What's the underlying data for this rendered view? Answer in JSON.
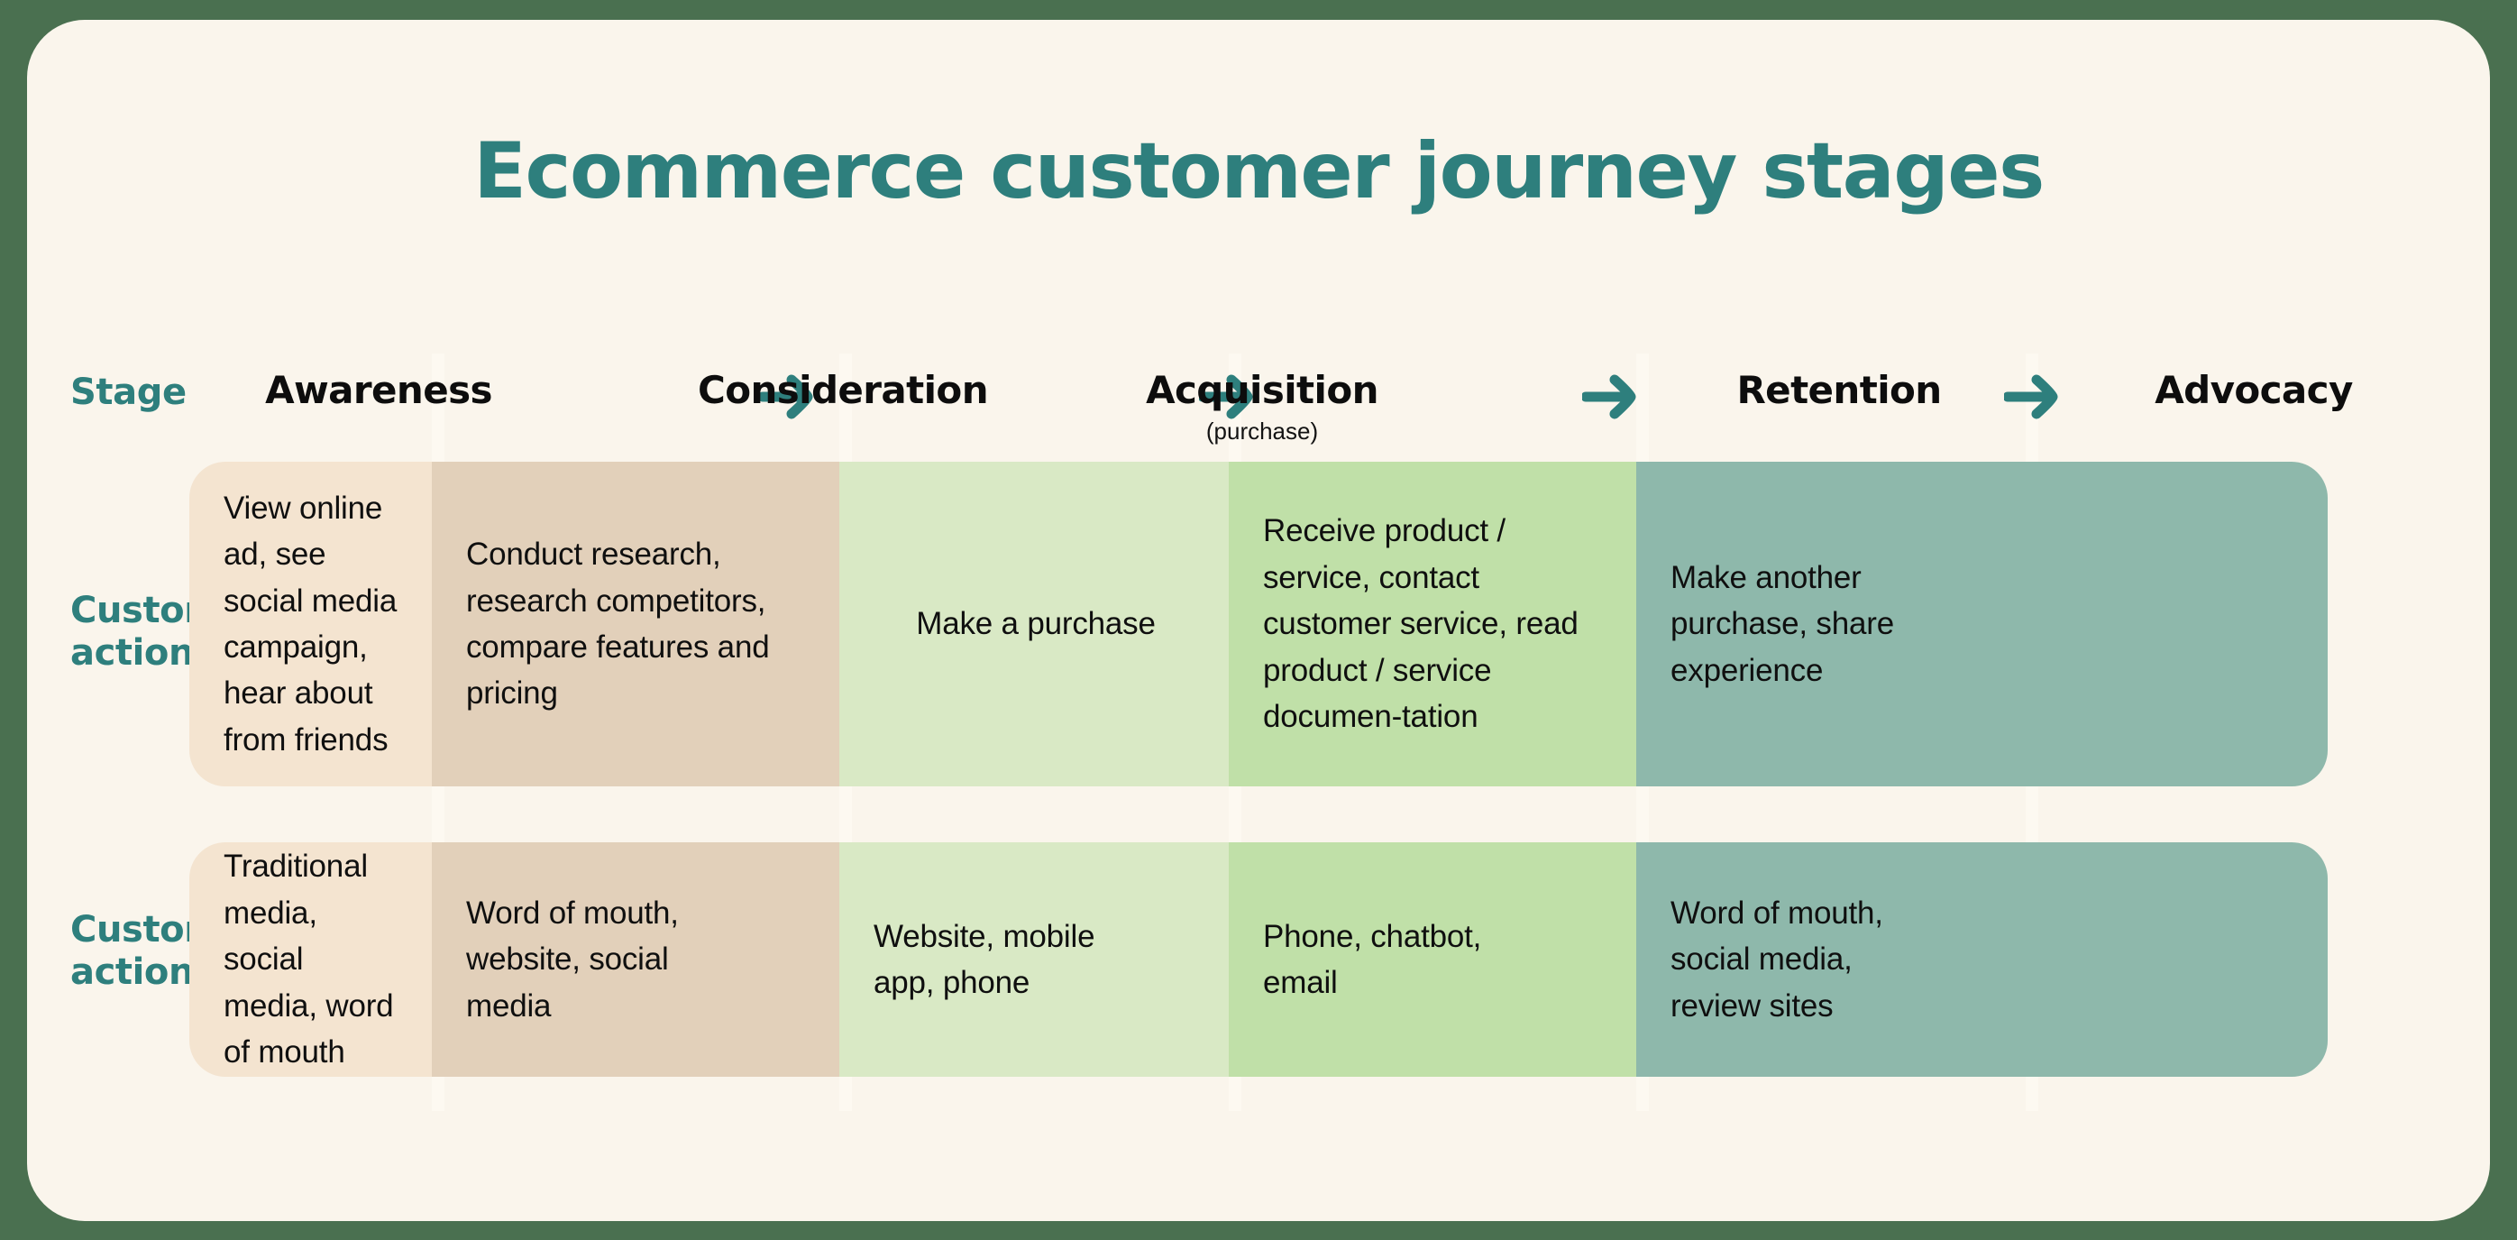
{
  "title": "Ecommerce customer journey stages",
  "colors": {
    "page_background": "#4a7050",
    "card_background": "#faf5ec",
    "accent_teal": "#2e7f7d",
    "text_dark": "#0f0f0f",
    "awareness": "#f4e4d0",
    "consideration": "#e2d0ba",
    "acquisition": "#d9e9c5",
    "retention": "#c0e0a8",
    "advocacy": "#8eb8ab"
  },
  "row_labels": {
    "stage": "Stage",
    "actions": "Customer\nactions",
    "actions_line1": "Customer",
    "actions_line2": "actions",
    "channels_line1": "Customer",
    "channels_line2": "actions"
  },
  "arrow_icon": "arrow-right-icon",
  "stages": [
    {
      "name": "Awareness",
      "subtitle": ""
    },
    {
      "name": "Consideration",
      "subtitle": ""
    },
    {
      "name": "Acquisition",
      "subtitle": "(purchase)"
    },
    {
      "name": "Retention",
      "subtitle": ""
    },
    {
      "name": "Advocacy",
      "subtitle": ""
    }
  ],
  "rows": [
    {
      "label_line1": "Customer",
      "label_line2": "actions",
      "cells": [
        "View online ad, see social media campaign, hear about from friends",
        "Conduct research, research competitors, compare features and pricing",
        "Make a purchase",
        "Receive product / service, contact customer service, read product / service documen-tation",
        "Make another purchase, share experience"
      ]
    },
    {
      "label_line1": "Customer",
      "label_line2": "actions",
      "cells": [
        "Traditional media, social media, word of mouth",
        "Word of mouth, website, social media",
        "Website, mobile app, phone",
        "Phone, chatbot, email",
        "Word of mouth, social media, review sites"
      ]
    }
  ],
  "chart_data": {
    "type": "table",
    "title": "Ecommerce customer journey stages",
    "categories": [
      "Awareness",
      "Consideration",
      "Acquisition",
      "Retention",
      "Advocacy"
    ],
    "column_subtitles": [
      "",
      "",
      "(purchase)",
      "",
      ""
    ],
    "row_headers": [
      "Stage",
      "Customer actions",
      "Customer actions"
    ],
    "series": [
      {
        "name": "Customer actions",
        "values": [
          "View online ad, see social media campaign, hear about from friends",
          "Conduct research, research competitors, compare features and pricing",
          "Make a purchase",
          "Receive product / service, contact customer service, read product / service documen-tation",
          "Make another purchase, share experience"
        ]
      },
      {
        "name": "Customer actions",
        "values": [
          "Traditional media, social media, word of mouth",
          "Word of mouth, website, social media",
          "Website, mobile app, phone",
          "Phone, chatbot, email",
          "Word of mouth, social media, review sites"
        ]
      }
    ],
    "column_colors": [
      "#f4e4d0",
      "#e2d0ba",
      "#d9e9c5",
      "#c0e0a8",
      "#8eb8ab"
    ],
    "legend": [],
    "grid": false
  }
}
